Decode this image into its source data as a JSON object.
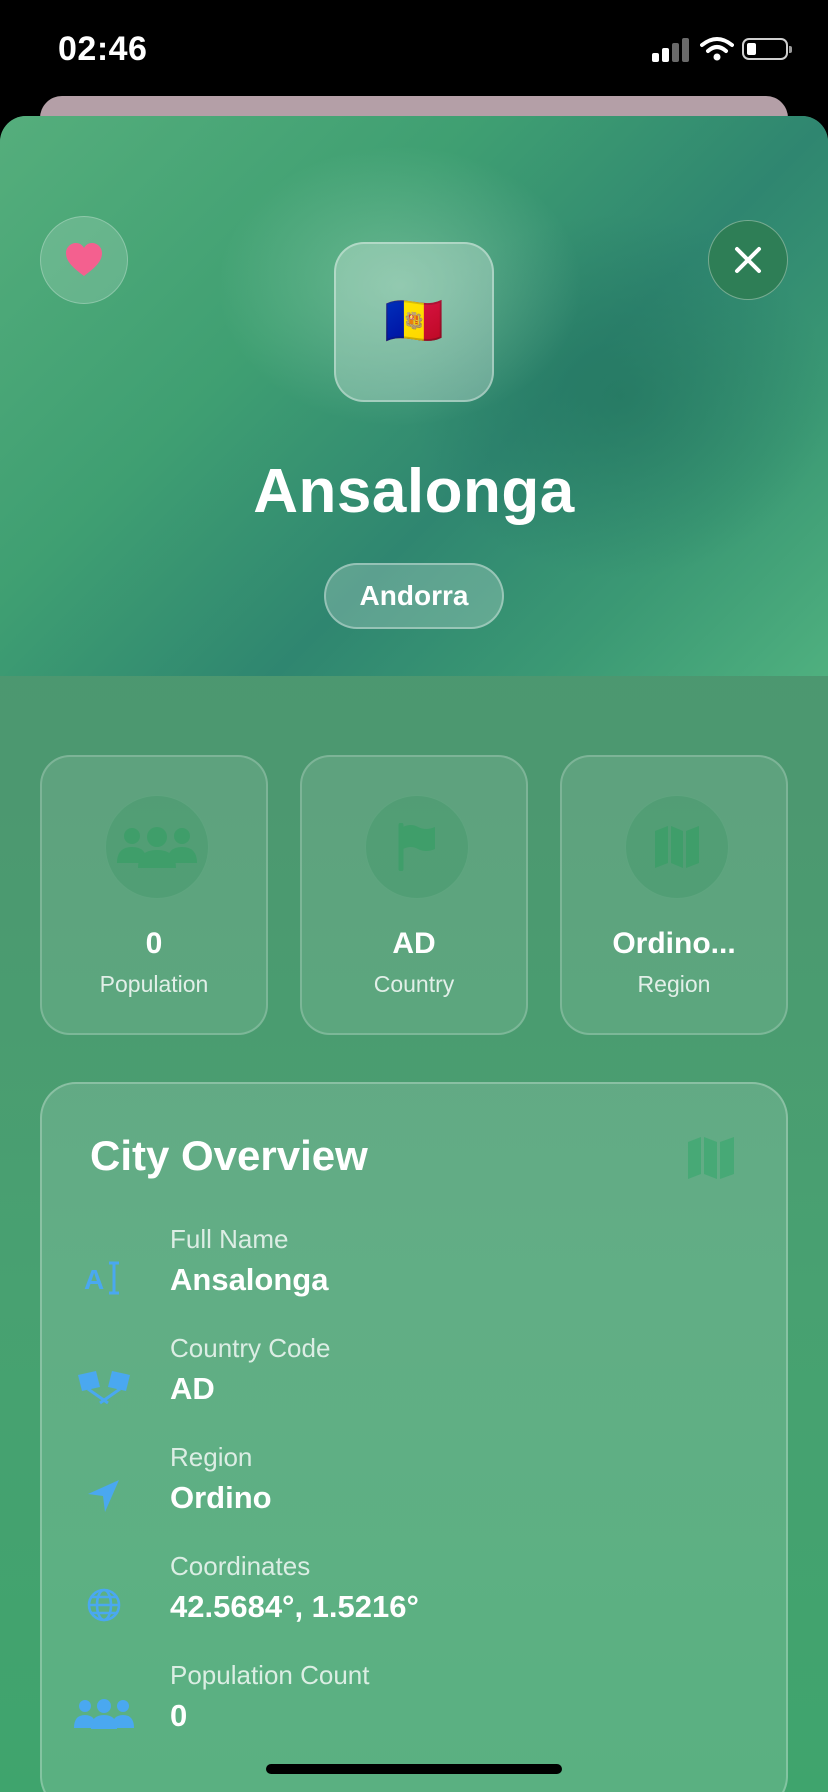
{
  "status_bar": {
    "time": "02:46"
  },
  "header": {
    "flag_emoji": "🇦🇩",
    "city_name": "Ansalonga",
    "country_name": "Andorra"
  },
  "stats": [
    {
      "value": "0",
      "label": "Population",
      "icon": "people-icon"
    },
    {
      "value": "AD",
      "label": "Country",
      "icon": "flag-icon"
    },
    {
      "value": "Ordino...",
      "label": "Region",
      "icon": "map-icon"
    }
  ],
  "overview": {
    "title": "City Overview",
    "rows": [
      {
        "label": "Full Name",
        "value": "Ansalonga",
        "icon": "text-cursor-icon"
      },
      {
        "label": "Country Code",
        "value": "AD",
        "icon": "flags-icon"
      },
      {
        "label": "Region",
        "value": "Ordino",
        "icon": "location-arrow-icon"
      },
      {
        "label": "Coordinates",
        "value": "42.5684°, 1.5216°",
        "icon": "globe-icon"
      },
      {
        "label": "Population Count",
        "value": "0",
        "icon": "people-icon"
      }
    ]
  },
  "colors": {
    "heart": "#f4608f",
    "row_icon": "#4aa8f0",
    "stat_icon": "#3f9e6a"
  }
}
